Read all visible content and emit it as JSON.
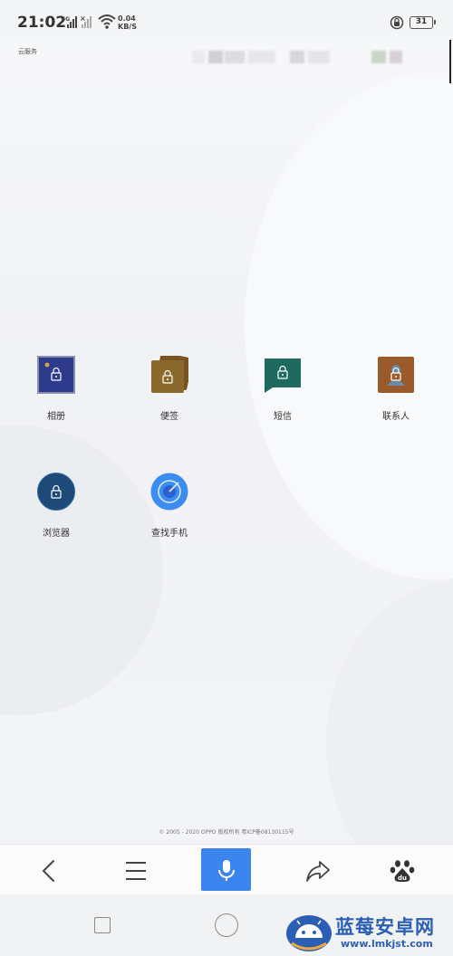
{
  "status_bar": {
    "time": "21:02",
    "network": "4G",
    "speed_value": "0.04",
    "speed_unit": "KB/S",
    "battery": "31"
  },
  "header": {
    "cloud_label": "云服务"
  },
  "apps": [
    {
      "label": "相册",
      "icon": "gallery-icon",
      "color": "#2e3a8c"
    },
    {
      "label": "便签",
      "icon": "notes-icon",
      "color": "#8a6a2c"
    },
    {
      "label": "短信",
      "icon": "messages-icon",
      "color": "#1f6a5e"
    },
    {
      "label": "联系人",
      "icon": "contacts-icon",
      "color": "#9a5a2a"
    },
    {
      "label": "浏览器",
      "icon": "browser-icon",
      "color": "#1d4a78"
    },
    {
      "label": "查找手机",
      "icon": "find-phone-icon",
      "color": "#3b8df2"
    }
  ],
  "footer": {
    "copyright": "© 2005 - 2020 OPPO 版权所有 粤ICP备08130115号"
  },
  "toolbar": {
    "accent": "#3b86ee"
  },
  "watermark": {
    "title": "蓝莓安卓网",
    "url": "www.lmkjst.com"
  }
}
